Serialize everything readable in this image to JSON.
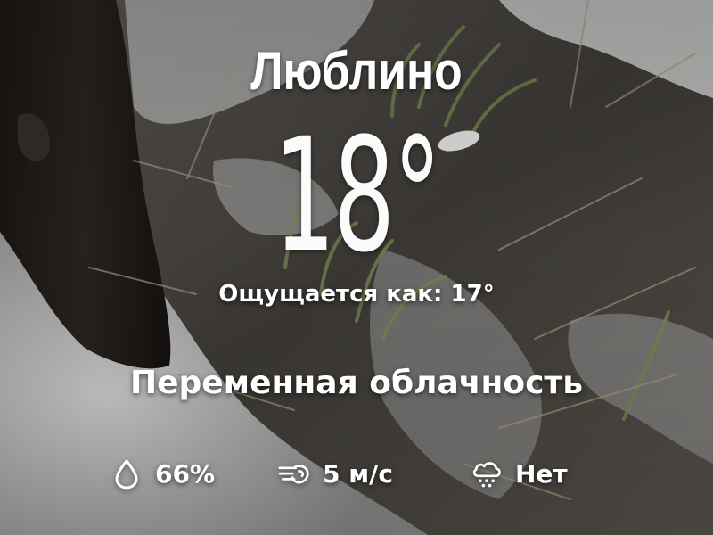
{
  "weather": {
    "city": "Люблино",
    "temperature": "18°",
    "feels_like": "Ощущается как: 17°",
    "condition": "Переменная облачность",
    "humidity": "66%",
    "wind": "5 м/с",
    "precipitation": "Нет"
  },
  "icons": {
    "humidity": "droplet-icon",
    "wind": "wind-icon",
    "precipitation": "cloud-snow-icon"
  },
  "colors": {
    "text": "#ffffff"
  }
}
